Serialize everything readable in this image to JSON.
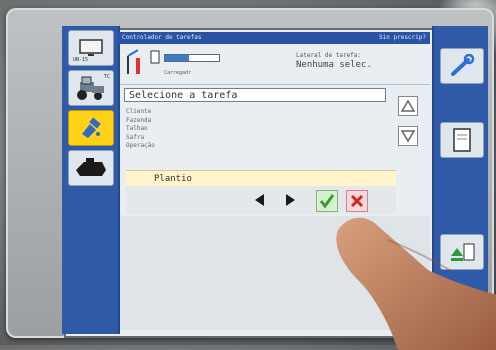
{
  "title_bar": {
    "left": "Controlador de tarefas",
    "right": "Sin prescrip?"
  },
  "left_panel": {
    "b1_caption": "UN-15",
    "b2_caption": "TC"
  },
  "header": {
    "sub_label": "Carregadr",
    "right_label_1": "Lateral de tarefa:",
    "right_label_2": "Nenhuma selec."
  },
  "select_field": {
    "value": "Selecione a tarefa"
  },
  "fields": [
    "Cliente",
    "Fazenda",
    "Talhao",
    "Safra",
    "Operação"
  ],
  "list": {
    "item": "Plantio"
  },
  "buttons": {
    "prev_icon": "triangle-left-icon",
    "next_icon": "triangle-right-icon",
    "ok_icon": "checkmark-icon",
    "cancel_icon": "x-icon"
  },
  "colors": {
    "panel_blue": "#2f5aa8",
    "accent_yellow": "#ffd21a",
    "ok_green": "#3a9a35",
    "cancel_red": "#d42424"
  }
}
